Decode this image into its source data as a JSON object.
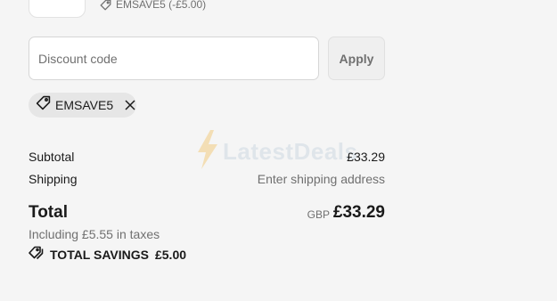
{
  "line_item": {
    "discount_tag_text": "EMSAVE5 (-£5.00)",
    "thumb_icon": "product-thumbnail",
    "tag_icon": "tag-icon"
  },
  "discount": {
    "placeholder": "Discount code",
    "value": "",
    "apply_label": "Apply"
  },
  "applied_code": {
    "label": "EMSAVE5",
    "tag_icon": "tag-icon",
    "remove_icon": "close-icon"
  },
  "summary": {
    "subtotal_label": "Subtotal",
    "subtotal_value": "£33.29",
    "shipping_label": "Shipping",
    "shipping_value": "Enter shipping address",
    "total_label": "Total",
    "total_currency": "GBP",
    "total_value": "£33.29",
    "tax_note": "Including £5.55 in taxes",
    "savings_label": "TOTAL SAVINGS",
    "savings_value": "£5.00",
    "savings_icon": "tags-icon"
  },
  "watermark": {
    "text": "LatestDeals",
    "icon": "lightning-bolt-icon"
  },
  "colors": {
    "background": "#f5f5f5",
    "text": "#1a1a1a",
    "muted_text": "#707070",
    "chip_background": "#e6e6e6",
    "button_background": "#efefef"
  }
}
